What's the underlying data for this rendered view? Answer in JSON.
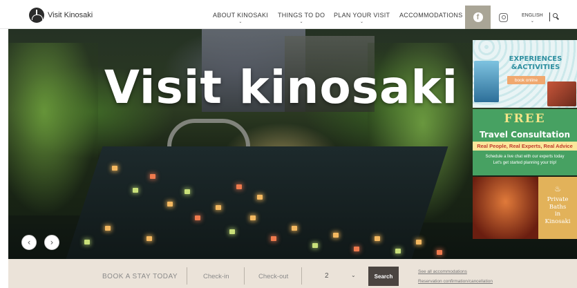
{
  "header": {
    "logo_text": "Visit Kinosaki",
    "nav": [
      {
        "label": "ABOUT KINOSAKI"
      },
      {
        "label": "THINGS TO DO"
      },
      {
        "label": "PLAN YOUR VISIT"
      },
      {
        "label": "ACCOMMODATIONS"
      }
    ],
    "caret": "⌄",
    "social": {
      "facebook_icon": "facebook-icon",
      "instagram_icon": "instagram-icon",
      "facebook_glyph": "f"
    },
    "language": "ENGLISH",
    "search_icon": "search-icon"
  },
  "hero": {
    "title": "Visit kinosaki",
    "prev_glyph": "‹",
    "next_glyph": "›"
  },
  "promos": {
    "experiences": {
      "title": "EXPERIENCES\n&ACTIVITIES",
      "button": "book online"
    },
    "consultation": {
      "free": "FREE",
      "title": "Travel Consultation",
      "tagline": "Real People, Real Experts, Real Advice",
      "sub1": "Schedule a live chat with our experts today",
      "sub2": "Let's get started planning your trip!"
    },
    "baths": {
      "title": "Private\nBaths\nin\nKinosaki",
      "icon_glyph": "♨"
    }
  },
  "booking": {
    "label": "BOOK A STAY TODAY",
    "checkin_placeholder": "Check-in",
    "checkout_placeholder": "Check-out",
    "guests_value": "2",
    "chevron": "⌄",
    "search_label": "Search",
    "link_all": "See all accommodations",
    "link_reservation": "Reservation confirmation/cancellation"
  },
  "colors": {
    "facebook_bg": "#a9a596",
    "booking_bg": "#ebe3d9",
    "search_button": "#4a4440",
    "consultation_green": "#47a162"
  }
}
